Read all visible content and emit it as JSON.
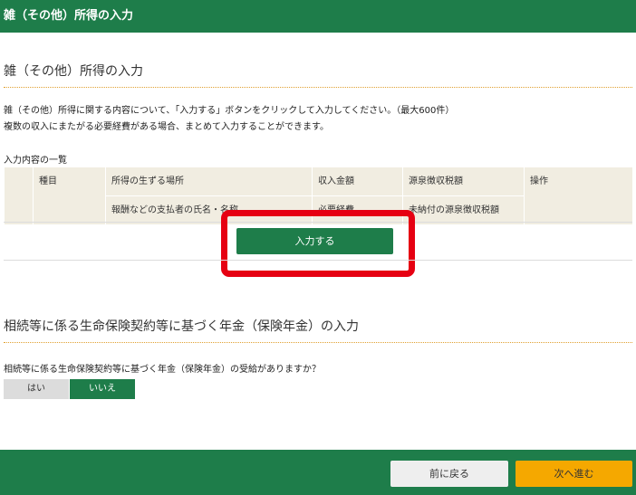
{
  "header": {
    "title": "雑（その他）所得の入力"
  },
  "section1": {
    "title": "雑（その他）所得の入力",
    "description_line1": "雑（その他）所得に関する内容について、「入力する」ボタンをクリックして入力してください。（最大600件）",
    "description_line2": "複数の収入にまたがる必要経費がある場合、まとめて入力することができます。",
    "list_label": "入力内容の一覧",
    "table": {
      "headers_row1": [
        "",
        "種目",
        "所得の生ずる場所",
        "収入金額",
        "源泉徴収税額",
        "操作"
      ],
      "headers_row2": [
        "報酬などの支払者の氏名・名称",
        "必要経費",
        "未納付の源泉徴収税額"
      ]
    },
    "input_button_label": "入力する"
  },
  "section2": {
    "title": "相続等に係る生命保険契約等に基づく年金（保険年金）の入力",
    "question": "相続等に係る生命保険契約等に基づく年金（保険年金）の受給がありますか？",
    "options": [
      "はい",
      "いいえ"
    ],
    "selected": "いいえ"
  },
  "footer": {
    "back_label": "前に戻る",
    "next_label": "次へ進む"
  },
  "colors": {
    "brand_green": "#1e7d4a",
    "next_orange": "#f5a800",
    "highlight_red": "#e60012",
    "table_header_bg": "#f1ede1"
  }
}
